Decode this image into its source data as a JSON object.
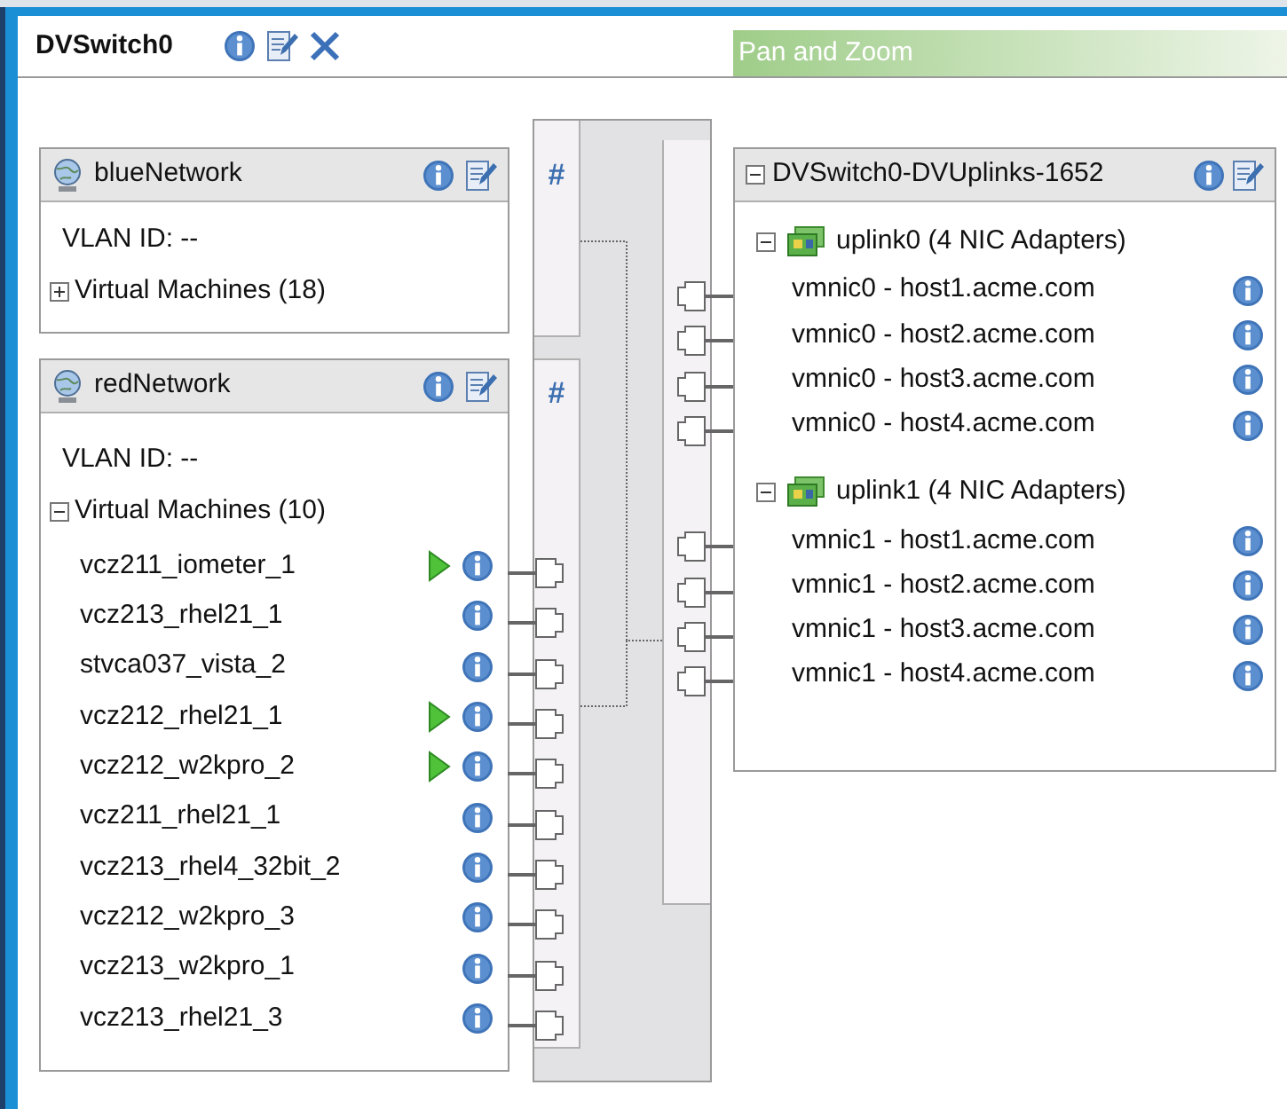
{
  "title": "DVSwitch0",
  "pan_zoom": {
    "title": "Pan and Zoom"
  },
  "port_groups": [
    {
      "name": "blueNetwork",
      "symbol": "#",
      "vlan": "VLAN ID: --",
      "vm_label": "Virtual Machines (18)",
      "expanded": false
    },
    {
      "name": "redNetwork",
      "symbol": "#",
      "vlan": "VLAN ID: --",
      "vm_label": "Virtual Machines (10)",
      "expanded": true,
      "vms": [
        {
          "name": "vcz211_iometer_1",
          "running": true
        },
        {
          "name": "vcz213_rhel21_1",
          "running": false
        },
        {
          "name": "stvca037_vista_2",
          "running": false
        },
        {
          "name": "vcz212_rhel21_1",
          "running": true
        },
        {
          "name": "vcz212_w2kpro_2",
          "running": true
        },
        {
          "name": "vcz211_rhel21_1",
          "running": false
        },
        {
          "name": "vcz213_rhel4_32bit_2",
          "running": false
        },
        {
          "name": "vcz212_w2kpro_3",
          "running": false
        },
        {
          "name": "vcz213_w2kpro_1",
          "running": false
        },
        {
          "name": "vcz213_rhel21_3",
          "running": false
        }
      ]
    }
  ],
  "uplinks": {
    "title": "DVSwitch0-DVUplinks-1652",
    "expanded": true,
    "groups": [
      {
        "name": "uplink0 (4 NIC Adapters)",
        "expanded": true,
        "nics": [
          "vmnic0 - host1.acme.com",
          "vmnic0 - host2.acme.com",
          "vmnic0 - host3.acme.com",
          "vmnic0 - host4.acme.com"
        ]
      },
      {
        "name": "uplink1 (4 NIC Adapters)",
        "expanded": true,
        "nics": [
          "vmnic1 - host1.acme.com",
          "vmnic1 - host2.acme.com",
          "vmnic1 - host3.acme.com",
          "vmnic1 - host4.acme.com"
        ]
      }
    ]
  }
}
